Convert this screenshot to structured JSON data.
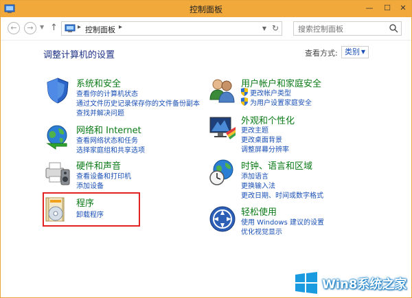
{
  "window": {
    "title": "控制面板",
    "controls": {
      "minimize": "—",
      "maximize": "☐",
      "close": "✕"
    }
  },
  "addressbar": {
    "back_icon": "back-arrow-icon",
    "forward_icon": "forward-arrow-icon",
    "breadcrumb": "控制面板",
    "search_placeholder": "搜索控制面板"
  },
  "main": {
    "page_title": "调整计算机的设置",
    "view_by_label": "查看方式:",
    "view_by_value": "类别"
  },
  "categories": {
    "system": {
      "title": "系统和安全",
      "links": [
        "查看你的计算机状态",
        "通过文件历史记录保存你的文件备份副本",
        "查找并解决问题"
      ]
    },
    "network": {
      "title": "网络和 Internet",
      "links": [
        "查看网络状态和任务",
        "选择家庭组和共享选项"
      ]
    },
    "hardware": {
      "title": "硬件和声音",
      "links": [
        "查看设备和打印机",
        "添加设备"
      ]
    },
    "programs": {
      "title": "程序",
      "links": [
        "卸载程序"
      ]
    },
    "users": {
      "title": "用户帐户和家庭安全",
      "links": [
        "更改帐户类型",
        "为用户设置家庭安全"
      ]
    },
    "appearance": {
      "title": "外观和个性化",
      "links": [
        "更改主题",
        "更改桌面背景",
        "调整屏幕分辨率"
      ]
    },
    "clock": {
      "title": "时钟、语言和区域",
      "links": [
        "添加语言",
        "更换输入法",
        "更改日期、时间或数字格式"
      ]
    },
    "ease": {
      "title": "轻松使用",
      "links": [
        "使用 Windows 建议的设置",
        "优化视觉显示"
      ]
    }
  },
  "watermark": {
    "text": "Win8系统之家"
  },
  "colors": {
    "titlebar": "#f2a93b",
    "category_title": "#0a7a16",
    "link": "#1a50b5",
    "highlight": "#e02222"
  }
}
